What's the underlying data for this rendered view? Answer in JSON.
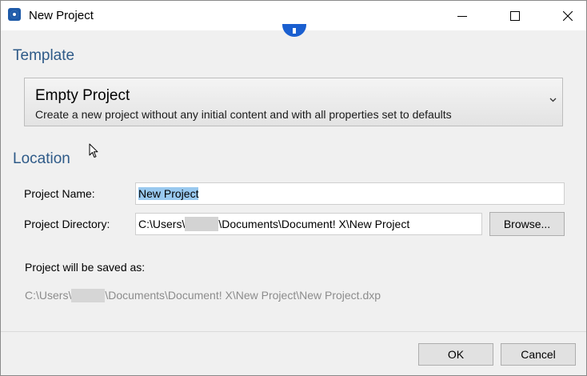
{
  "window": {
    "title": "New Project",
    "controls": {
      "minimize": "minimize-icon",
      "maximize": "maximize-icon",
      "close": "close-icon"
    }
  },
  "template": {
    "heading": "Template",
    "selected_name": "Empty Project",
    "selected_description": "Create a new project without any initial content and with all properties set to defaults"
  },
  "location": {
    "heading": "Location",
    "project_name_label": "Project Name:",
    "project_name_value": "New Project",
    "project_directory_label": "Project Directory:",
    "project_directory_prefix": "C:\\Users\\",
    "project_directory_suffix": "\\Documents\\Document! X\\New Project",
    "browse_label": "Browse...",
    "saved_as_label": "Project will be saved as:",
    "saved_path_prefix": "C:\\Users\\",
    "saved_path_suffix": "\\Documents\\Document! X\\New Project\\New Project.dxp"
  },
  "footer": {
    "ok_label": "OK",
    "cancel_label": "Cancel"
  },
  "colors": {
    "heading": "#2e5a88",
    "selection": "#99c9ef",
    "badge": "#1a5fd0",
    "app_icon": "#1e5aa8"
  }
}
